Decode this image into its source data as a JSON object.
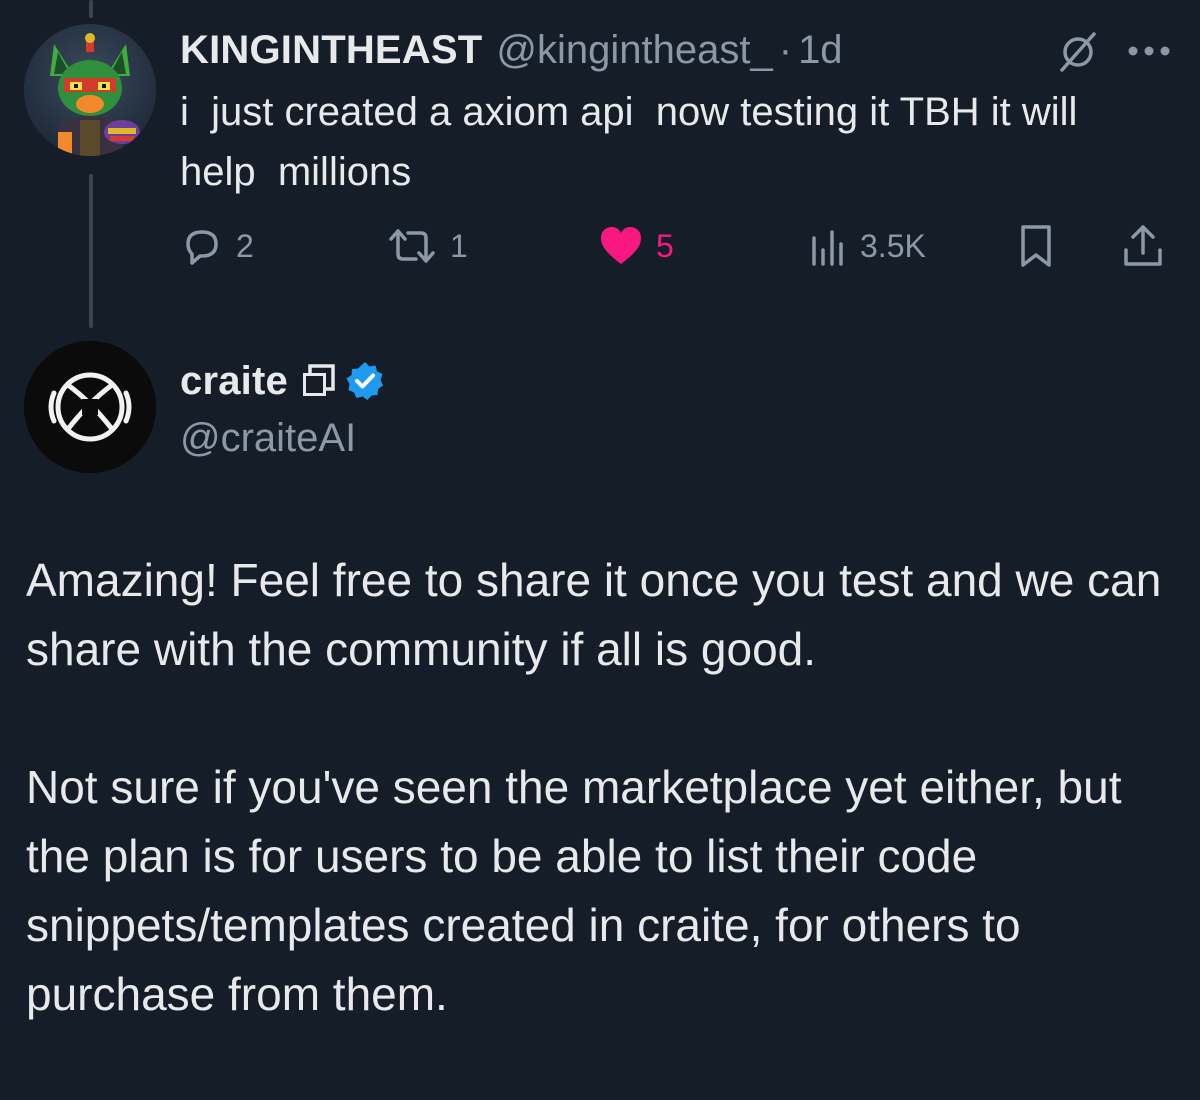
{
  "tweet1": {
    "display_name": "KINGINTHEAST",
    "handle": "@kingintheast_",
    "separator": "·",
    "time_ago": "1d",
    "text": "i  just created a axiom api  now testing it TBH it will help  millions",
    "actions": {
      "replies": "2",
      "reposts": "1",
      "likes": "5",
      "views": "3.5K"
    },
    "icons": [
      "grok-icon",
      "more-icon",
      "reply-icon",
      "repost-icon",
      "like-icon",
      "views-icon",
      "bookmark-icon",
      "share-icon"
    ]
  },
  "tweet2": {
    "display_name": "craite",
    "handle": "@craiteAI",
    "badges": [
      "affiliate-badge-icon",
      "verified-badge-icon"
    ],
    "paragraphs": [
      "Amazing! Feel free to share it once you test and we can share with the community if all is good.",
      "Not sure if you've seen the marketplace yet either, but the plan is for users to be able to list their code snippets/templates created in craite, for others to purchase from them."
    ]
  },
  "colors": {
    "background": "#151d28",
    "primary_text": "#e7e9ea",
    "secondary_text": "#8b98a5",
    "like": "#f91880",
    "verified": "#1d9bf0",
    "thread_line": "#3a4552"
  }
}
